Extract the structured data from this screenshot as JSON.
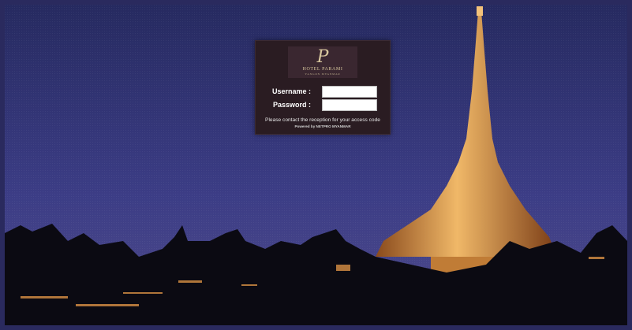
{
  "login": {
    "logo": {
      "mark": "P",
      "name": "HOTEL PARAMI",
      "tagline": "YANGON MYANMAR"
    },
    "username_label": "Username :",
    "username_value": "",
    "password_label": "Password :",
    "password_value": "",
    "notice": "Please contact the reception for your access code",
    "powered_by": "Powered by NETPRO MYANMAR"
  },
  "colors": {
    "sky_top": "#272a63",
    "sky_bottom": "#4a4a92",
    "panel_bg": "#2a1c22",
    "pagoda_gold": "#e2a24a"
  }
}
